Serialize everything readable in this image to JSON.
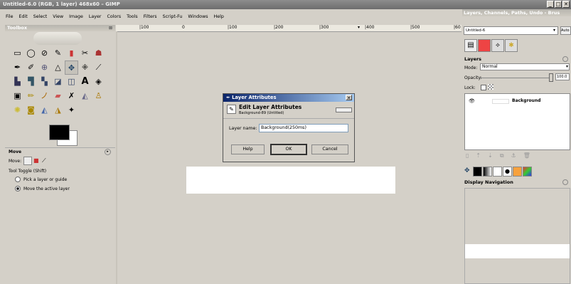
{
  "window": {
    "title": "Untitled-6.0 (RGB, 1 layer) 468x60 – GIMP",
    "min": "_",
    "max": "□",
    "close": "✕"
  },
  "menu": [
    "File",
    "Edit",
    "Select",
    "View",
    "Image",
    "Layer",
    "Colors",
    "Tools",
    "Filters",
    "Script-Fu",
    "Windows",
    "Help"
  ],
  "toolbox": {
    "title": "Toolbox",
    "tool_options_title": "Move",
    "move_label": "Move:",
    "tool_toggle": "Tool Toggle  (Shift)",
    "options": [
      "Pick a layer or guide",
      "Move the active layer"
    ]
  },
  "ruler": {
    "ticks": [
      "|100",
      "0",
      "|100",
      "|200",
      "|300",
      "|400",
      "|500",
      "|60"
    ]
  },
  "dialog": {
    "title": "Layer Attributes",
    "heading": "Edit Layer Attributes",
    "subheading": "Background-89 (Untitled)",
    "layer_name_label": "Layer name:",
    "layer_name_value": "Background(250ms)",
    "help": "Help",
    "ok": "OK",
    "cancel": "Cancel"
  },
  "layers_panel": {
    "title": "Layers, Channels, Paths, Undo - Brus",
    "image_select": "Untitled-6",
    "auto": "Auto",
    "section_title": "Layers",
    "mode_label": "Mode:",
    "mode_value": "Normal",
    "opacity_label": "Opacity:",
    "opacity_value": "100.0",
    "lock_label": "Lock:",
    "layer_name": "Background",
    "nav_title": "Display Navigation"
  }
}
